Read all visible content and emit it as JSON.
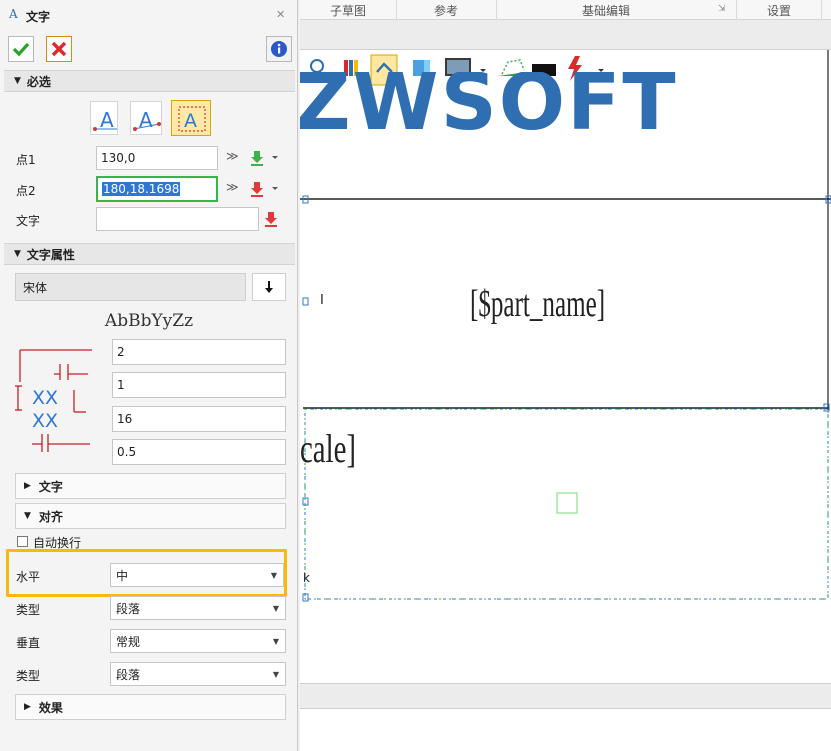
{
  "dialog": {
    "title": "文字",
    "close_icon": "✕"
  },
  "required": {
    "header": "必选",
    "point1_label": "点1",
    "point1_value": "130,0",
    "point2_label": "点2",
    "point2_value": "180,18.1698",
    "text_label": "文字",
    "text_value": ""
  },
  "text_props": {
    "header": "文字属性",
    "font_name": "宋体",
    "preview": "AbBbYyZz",
    "spacing_values": [
      "2",
      "1",
      "16",
      "0.5"
    ]
  },
  "subsections": {
    "text_label": "文字",
    "align_label": "对齐",
    "auto_wrap_label": "自动换行",
    "horizontal_label": "水平",
    "horizontal_value": "中",
    "type1_label": "类型",
    "type1_value": "段落",
    "vertical_label": "垂直",
    "vertical_value": "常规",
    "type2_label": "类型",
    "type2_value": "段落",
    "effect_label": "效果"
  },
  "ribbon": {
    "tabs": [
      "子草图",
      "参考",
      "基础编辑",
      "设置"
    ]
  },
  "canvas": {
    "logo": "ZWSOFT",
    "part_name": "[$part_name]",
    "scale_fragment": "cale]",
    "cursor_text": "I",
    "k_fragment": "k"
  },
  "colors": {
    "accent": "#2f6eb0",
    "highlight": "#ffb800",
    "selection_green": "#3bb34a",
    "selection_blue": "#2d78d5"
  }
}
